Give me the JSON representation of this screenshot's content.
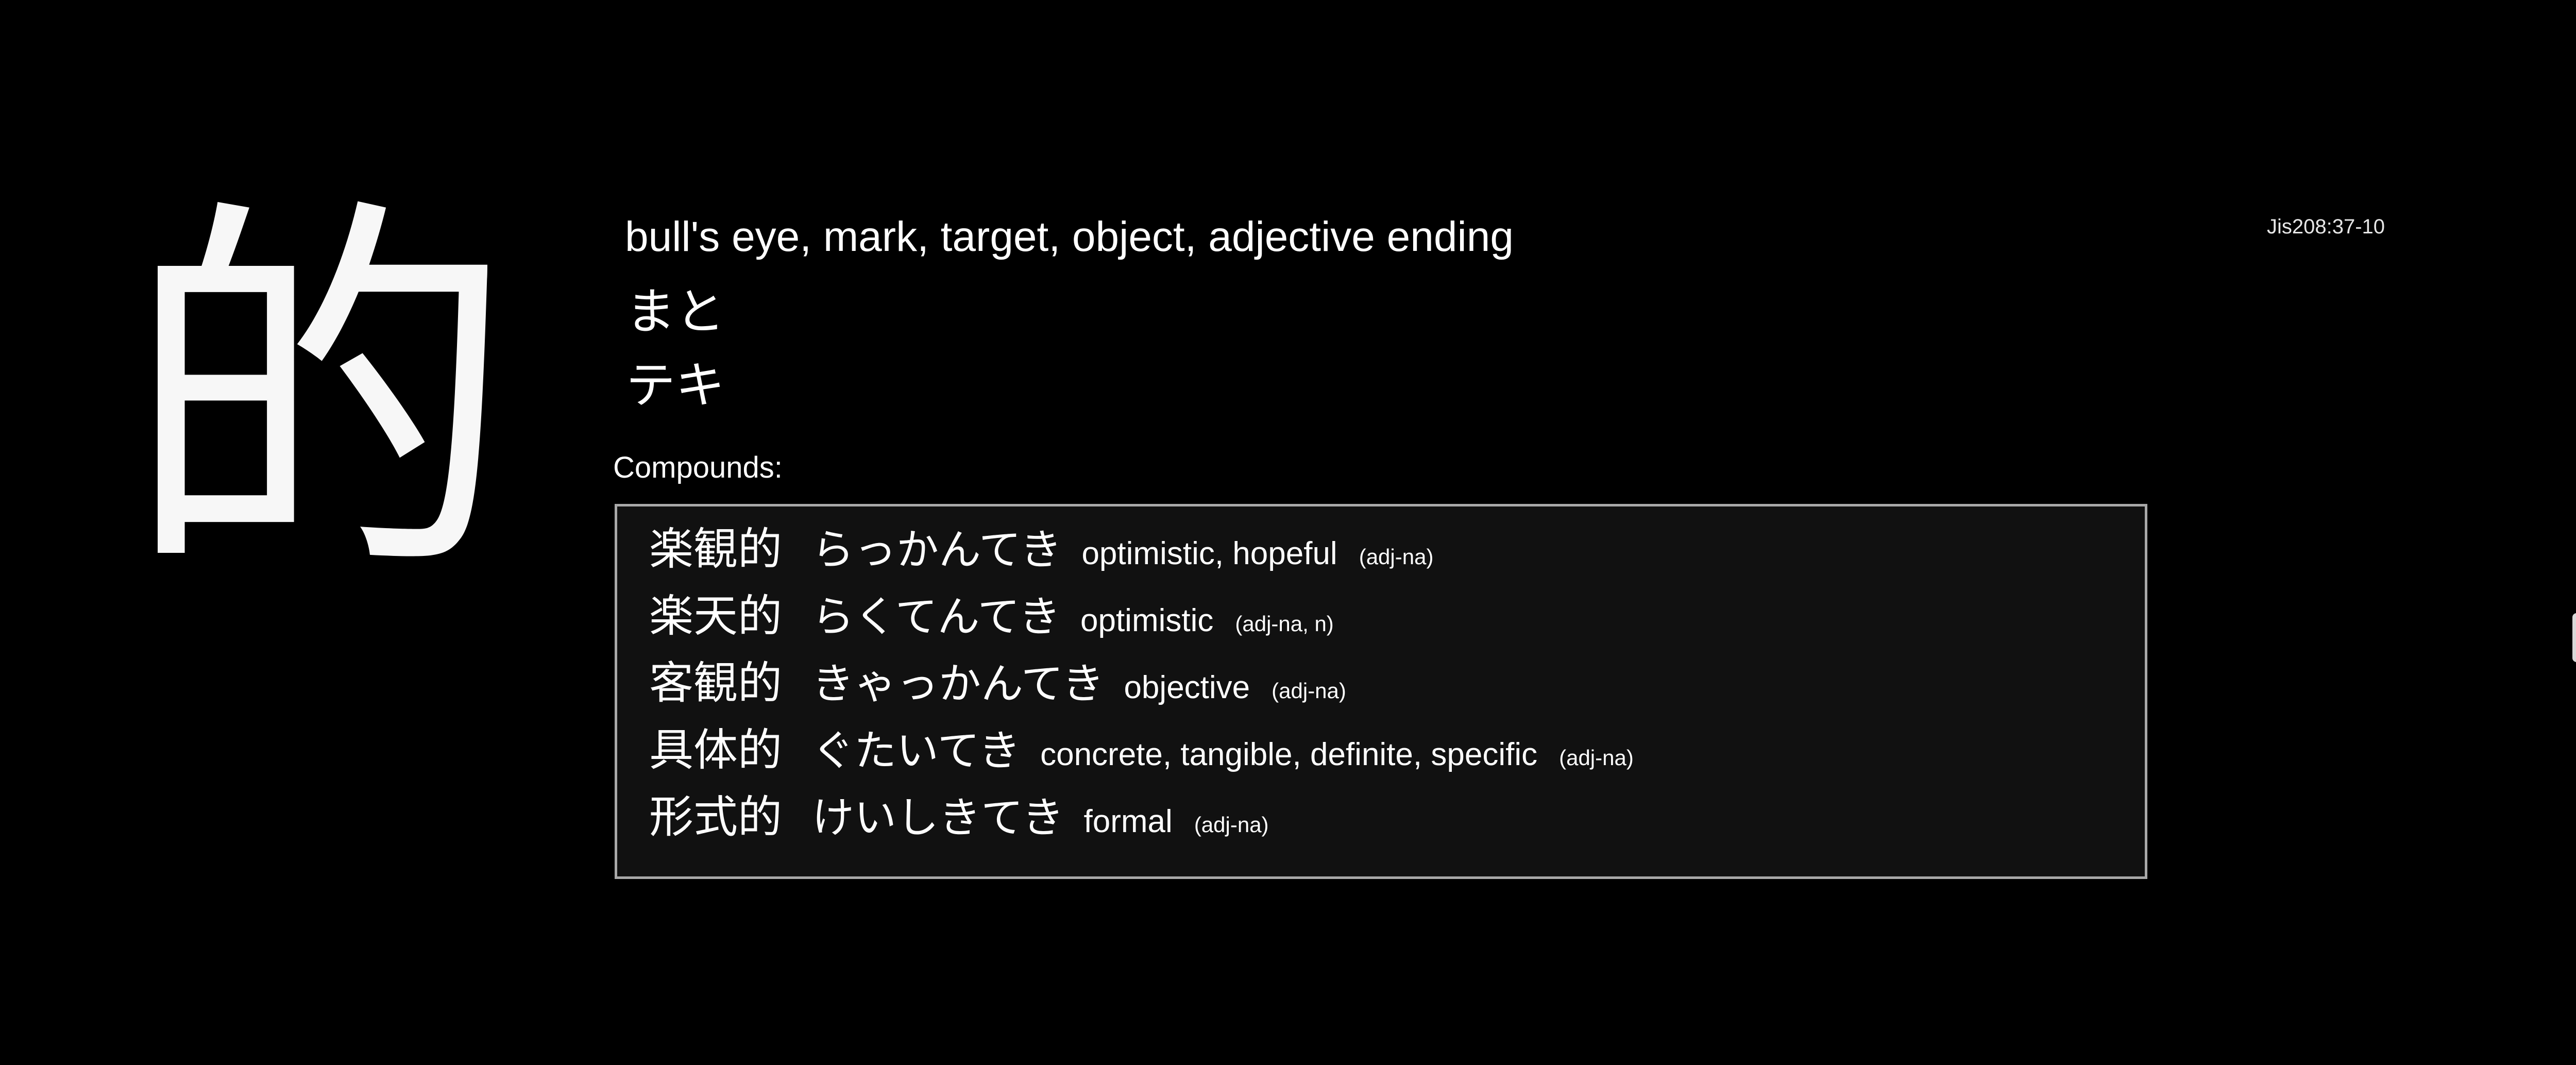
{
  "kanji": "的",
  "jis_code": "Jis208:37-10",
  "meaning": "bull's eye, mark, target, object, adjective ending",
  "readings": {
    "kun": "まと",
    "on": "テキ"
  },
  "compounds_label": "Compounds:",
  "compounds": [
    {
      "kanji": "楽観的",
      "kana": "らっかんてき",
      "gloss": "optimistic, hopeful",
      "pos": "(adj-na)"
    },
    {
      "kanji": "楽天的",
      "kana": "らくてんてき",
      "gloss": "optimistic",
      "pos": "(adj-na, n)"
    },
    {
      "kanji": "客観的",
      "kana": "きゃっかんてき",
      "gloss": "objective",
      "pos": "(adj-na)"
    },
    {
      "kanji": "具体的",
      "kana": "ぐたいてき",
      "gloss": "concrete, tangible, definite, specific",
      "pos": "(adj-na)"
    },
    {
      "kanji": "形式的",
      "kana": "けいしきてき",
      "gloss": "formal",
      "pos": "(adj-na)"
    }
  ]
}
